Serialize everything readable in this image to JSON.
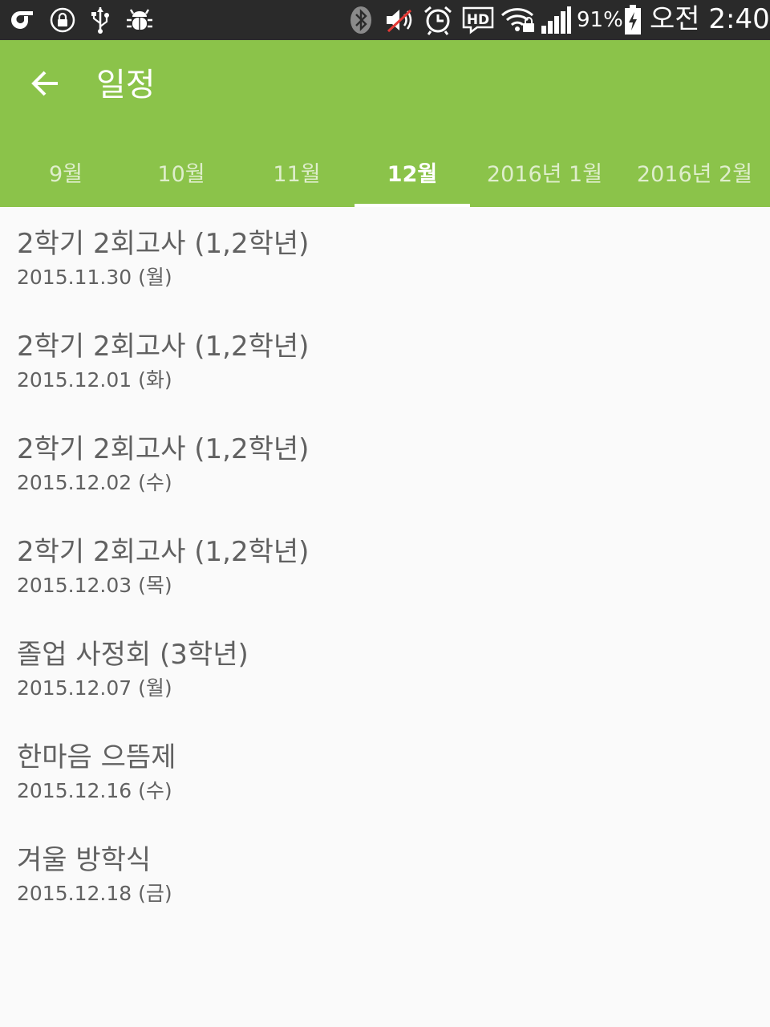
{
  "status_bar": {
    "icons_left": [
      "carrier-logo-icon",
      "lock-icon",
      "usb-icon",
      "debug-bug-icon"
    ],
    "icons_right": [
      "bluetooth-icon",
      "volume-muted-icon",
      "alarm-icon",
      "hd-voice-icon",
      "wifi-lock-icon",
      "signal-icon"
    ],
    "battery_percent": "91%",
    "battery_icon": "battery-charging-icon",
    "time": "오전 2:40"
  },
  "app_bar": {
    "back_icon": "arrow-left-icon",
    "title": "일정",
    "background_color": "#8bc34a",
    "tabs": [
      {
        "label": "9월",
        "active": false
      },
      {
        "label": "10월",
        "active": false
      },
      {
        "label": "11월",
        "active": false
      },
      {
        "label": "12월",
        "active": true
      },
      {
        "label": "2016년 1월",
        "active": false
      },
      {
        "label": "2016년 2월",
        "active": false
      }
    ]
  },
  "schedule": {
    "items": [
      {
        "title": "2학기 2회고사 (1,2학년)",
        "date": "2015.11.30 (월)"
      },
      {
        "title": "2학기 2회고사 (1,2학년)",
        "date": "2015.12.01 (화)"
      },
      {
        "title": "2학기 2회고사 (1,2학년)",
        "date": "2015.12.02 (수)"
      },
      {
        "title": "2학기 2회고사 (1,2학년)",
        "date": "2015.12.03 (목)"
      },
      {
        "title": "졸업 사정회 (3학년)",
        "date": "2015.12.07 (월)"
      },
      {
        "title": "한마음 으뜸제",
        "date": "2015.12.16 (수)"
      },
      {
        "title": "겨울 방학식",
        "date": "2015.12.18 (금)"
      }
    ]
  }
}
